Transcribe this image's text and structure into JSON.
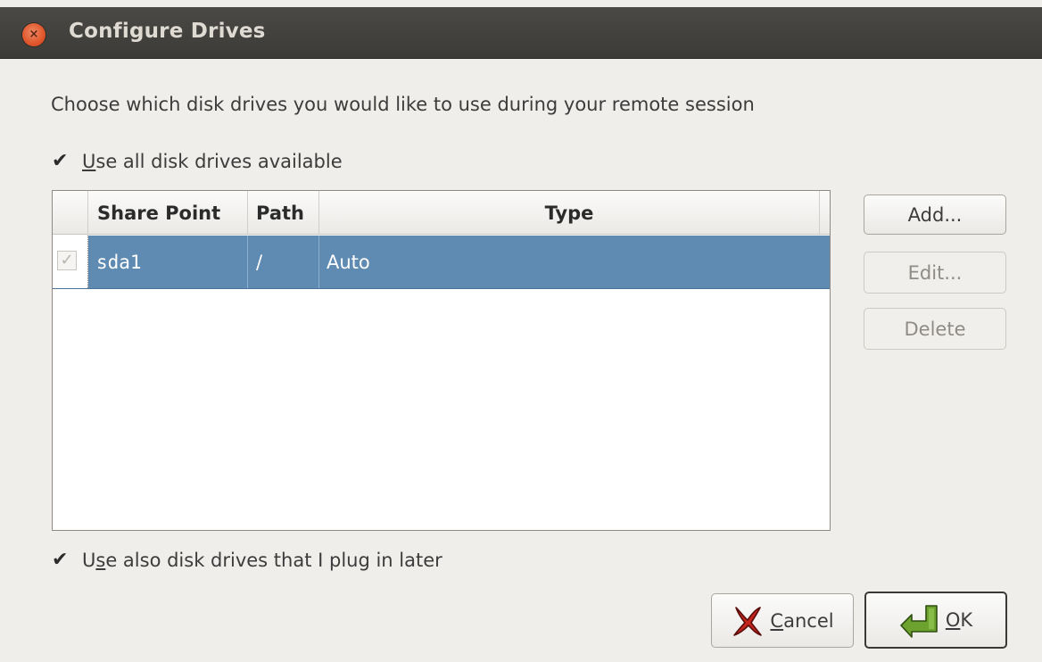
{
  "window": {
    "title": "Configure Drives",
    "close_label": "×"
  },
  "description": "Choose which disk drives you would like to use during your remote session",
  "use_all": {
    "checked": true,
    "check_glyph": "✔",
    "label_accel": "U",
    "label_rest": "se all disk drives available"
  },
  "table": {
    "columns": [
      "Share Point",
      "Path",
      "Type"
    ],
    "rows": [
      {
        "checked": true,
        "check_glyph": "✓",
        "share_point": "sda1",
        "path": "/",
        "type": "Auto",
        "selected": true
      }
    ]
  },
  "buttons": {
    "add": "Add...",
    "edit": "Edit...",
    "delete": "Delete",
    "cancel_accel": "C",
    "cancel_rest": "ancel",
    "ok_accel": "O",
    "ok_rest": "K"
  },
  "use_later": {
    "checked": true,
    "check_glyph": "✔",
    "label_pre": "U",
    "label_accel": "s",
    "label_rest": "e also disk drives that I plug in later"
  },
  "colors": {
    "selection": "#5f8bb3",
    "titlebar": "#3c3b37",
    "close_button": "#e0552b"
  }
}
